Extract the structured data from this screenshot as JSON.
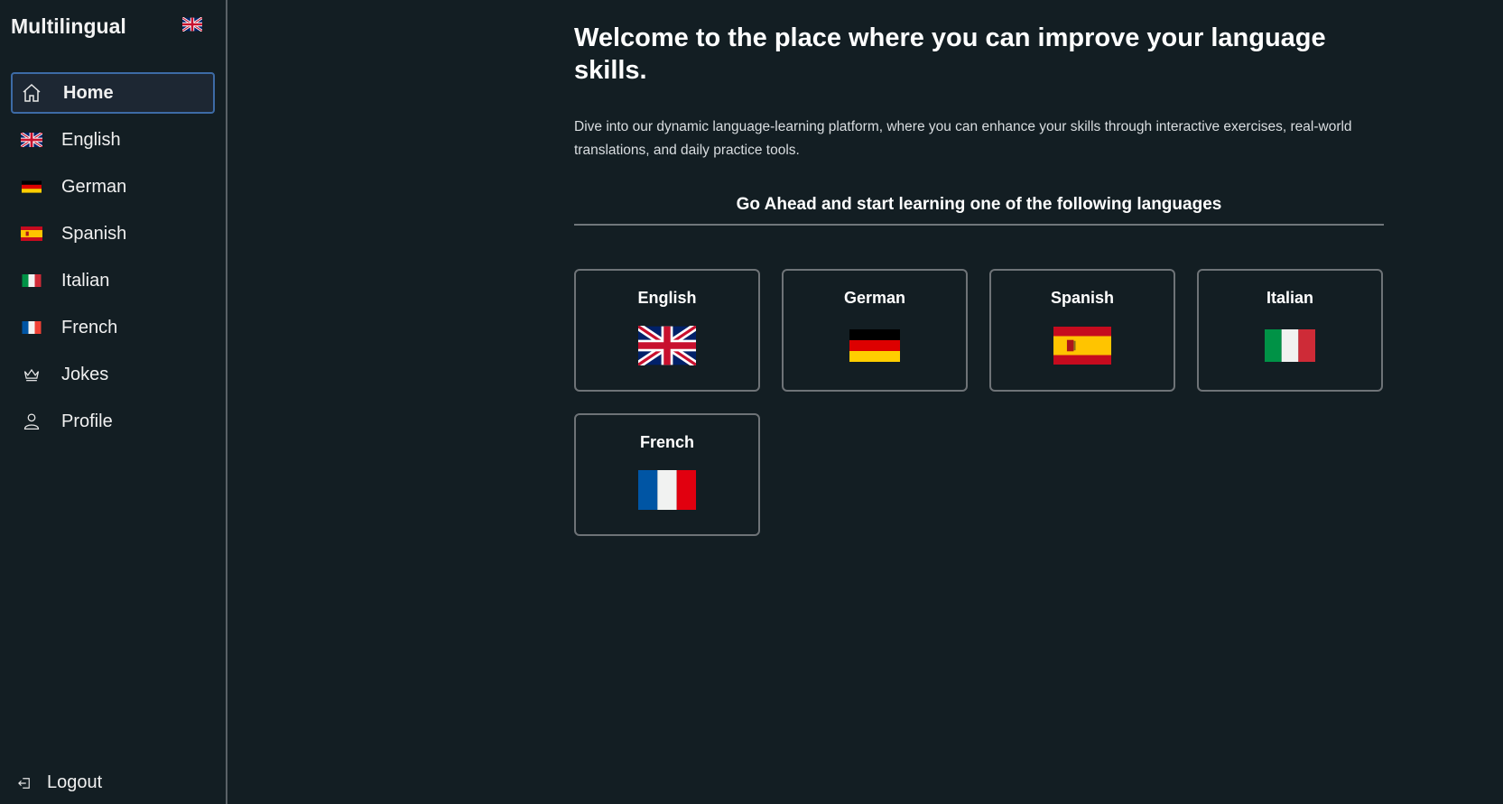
{
  "sidebar": {
    "brand": "Multilingual",
    "brand_flag_icon": "uk-flag-icon",
    "items": [
      {
        "label": "Home",
        "icon": "home-icon",
        "active": true
      },
      {
        "label": "English",
        "icon": "uk-flag-icon"
      },
      {
        "label": "German",
        "icon": "german-flag-icon"
      },
      {
        "label": "Spanish",
        "icon": "spanish-flag-icon"
      },
      {
        "label": "Italian",
        "icon": "italian-flag-icon"
      },
      {
        "label": "French",
        "icon": "french-flag-icon"
      },
      {
        "label": "Jokes",
        "icon": "crown-icon"
      },
      {
        "label": "Profile",
        "icon": "user-icon"
      }
    ],
    "logout": {
      "label": "Logout",
      "icon": "logout-icon"
    }
  },
  "main": {
    "headline": "Welcome to the place where you can improve your language skills.",
    "intro": "Dive into our dynamic language-learning platform, where you can enhance your skills through interactive exercises, real-world translations, and daily practice tools.",
    "section_title": "Go Ahead and start learning one of the following languages",
    "languages": [
      {
        "name": "English",
        "icon": "uk-flag-icon"
      },
      {
        "name": "German",
        "icon": "german-flag-icon"
      },
      {
        "name": "Spanish",
        "icon": "spanish-flag-icon"
      },
      {
        "name": "Italian",
        "icon": "italian-flag-icon"
      },
      {
        "name": "French",
        "icon": "french-flag-icon"
      }
    ]
  },
  "colors": {
    "background": "#131e23",
    "active_border": "#3d6ba6",
    "active_bg": "#1d2733",
    "card_border": "#6e7377"
  }
}
